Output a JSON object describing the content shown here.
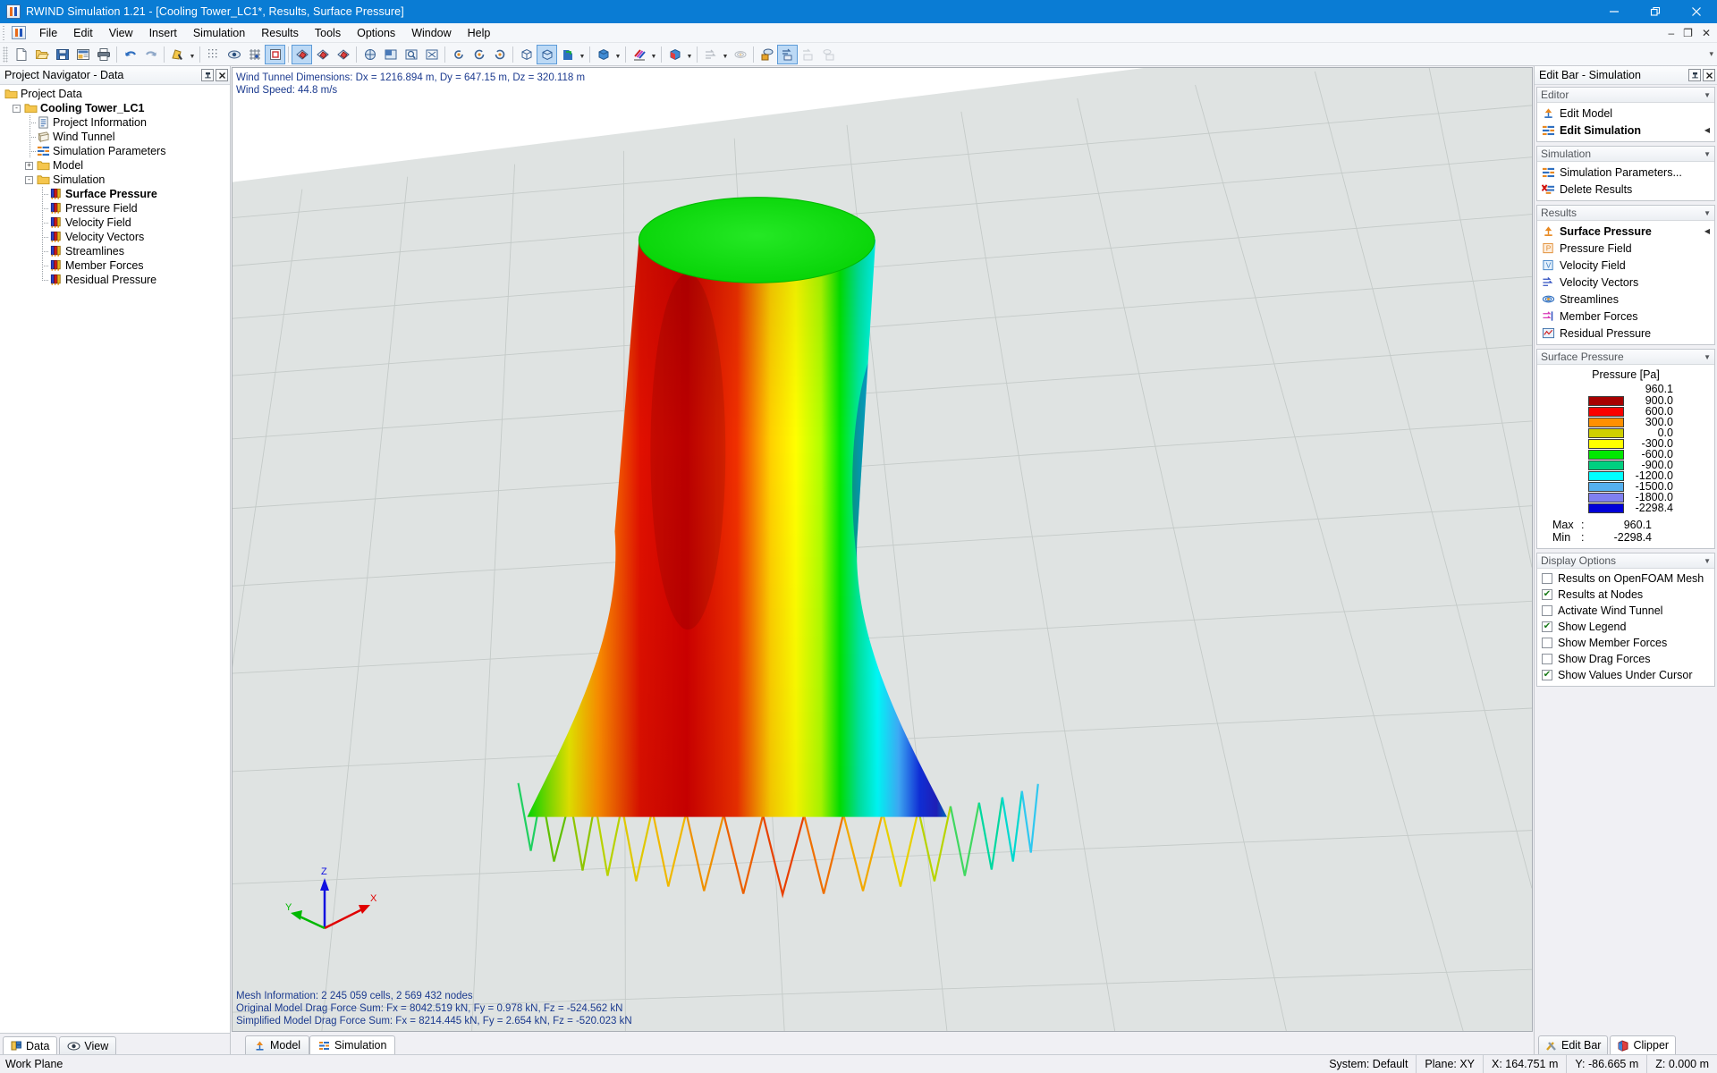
{
  "window": {
    "title": "RWIND Simulation 1.21 - [Cooling Tower_LC1*, Results, Surface Pressure]",
    "app_icon": "rwind-app-icon",
    "minimize": "–",
    "restore": "❐",
    "close": "✕"
  },
  "inner_window": {
    "minimize": "–",
    "restore": "❐",
    "close": "✕"
  },
  "menu": {
    "items": [
      {
        "label": "File"
      },
      {
        "label": "Edit"
      },
      {
        "label": "View"
      },
      {
        "label": "Insert"
      },
      {
        "label": "Simulation"
      },
      {
        "label": "Results"
      },
      {
        "label": "Tools"
      },
      {
        "label": "Options"
      },
      {
        "label": "Window"
      },
      {
        "label": "Help"
      }
    ]
  },
  "toolbar": {
    "groups": [
      {
        "buttons": [
          {
            "name": "new-icon"
          },
          {
            "name": "open-icon"
          },
          {
            "name": "save-icon"
          },
          {
            "name": "print-preview-icon"
          },
          {
            "name": "print-icon"
          }
        ]
      },
      {
        "buttons": [
          {
            "name": "undo-icon"
          },
          {
            "name": "redo-icon"
          }
        ]
      },
      {
        "buttons": [
          {
            "name": "select-objects-icon",
            "dropdown": true
          }
        ]
      },
      {
        "buttons": [
          {
            "name": "snap-grid-icon"
          },
          {
            "name": "object-snap-icon"
          },
          {
            "name": "grid-points-icon"
          },
          {
            "name": "work-plane-icon",
            "active": true
          }
        ]
      },
      {
        "buttons": [
          {
            "name": "view-xy-icon",
            "active": true
          },
          {
            "name": "view-xz-icon"
          },
          {
            "name": "view-yz-icon"
          }
        ]
      },
      {
        "buttons": [
          {
            "name": "pan-icon"
          },
          {
            "name": "zoom-window-icon"
          },
          {
            "name": "zoom-region-icon"
          },
          {
            "name": "zoom-all-icon"
          }
        ]
      },
      {
        "buttons": [
          {
            "name": "rotate-left-icon"
          },
          {
            "name": "rotate-icon"
          },
          {
            "name": "rotate-right-icon"
          }
        ]
      },
      {
        "buttons": [
          {
            "name": "wireframe-icon"
          },
          {
            "name": "solid-view-icon",
            "active": true
          },
          {
            "name": "render-mode-icon",
            "dropdown": true
          }
        ]
      },
      {
        "buttons": [
          {
            "name": "model-display-icon",
            "dropdown": true
          }
        ]
      },
      {
        "buttons": [
          {
            "name": "colors-icon",
            "dropdown": true
          }
        ]
      },
      {
        "buttons": [
          {
            "name": "surface-results-icon",
            "dropdown": true
          }
        ]
      },
      {
        "buttons": [
          {
            "name": "velocity-vectors-icon",
            "dropdown": true,
            "disabled": true
          },
          {
            "name": "streamlines-icon",
            "disabled": true
          }
        ]
      },
      {
        "buttons": [
          {
            "name": "results-on-surface-icon"
          },
          {
            "name": "results-values-icon",
            "active": true
          },
          {
            "name": "results-isolines-icon",
            "disabled": true
          },
          {
            "name": "results-table-icon",
            "disabled": true
          }
        ]
      }
    ],
    "overflow": "▾"
  },
  "project_navigator": {
    "title": "Project Navigator - Data",
    "pin_glyph": "⚲",
    "close_glyph": "✕",
    "tree": [
      {
        "label": "Project Data",
        "depth": 0,
        "icon": "folder-icon",
        "toggle": "none",
        "bold": false
      },
      {
        "label": "Cooling Tower_LC1",
        "depth": 1,
        "icon": "folder-icon",
        "toggle": "minus",
        "bold": true
      },
      {
        "label": "Project Information",
        "depth": 2,
        "icon": "document-icon",
        "toggle": "none",
        "bold": false
      },
      {
        "label": "Wind Tunnel",
        "depth": 2,
        "icon": "wind-tunnel-icon",
        "toggle": "none",
        "bold": false
      },
      {
        "label": "Simulation Parameters",
        "depth": 2,
        "icon": "sim-params-icon",
        "toggle": "none",
        "bold": false
      },
      {
        "label": "Model",
        "depth": 2,
        "icon": "folder-icon",
        "toggle": "plus",
        "bold": false
      },
      {
        "label": "Simulation",
        "depth": 2,
        "icon": "folder-icon",
        "toggle": "minus",
        "bold": false
      },
      {
        "label": "Surface Pressure",
        "depth": 3,
        "icon": "results-icon",
        "toggle": "none",
        "bold": true
      },
      {
        "label": "Pressure Field",
        "depth": 3,
        "icon": "results-icon",
        "toggle": "none",
        "bold": false
      },
      {
        "label": "Velocity Field",
        "depth": 3,
        "icon": "results-icon",
        "toggle": "none",
        "bold": false
      },
      {
        "label": "Velocity Vectors",
        "depth": 3,
        "icon": "results-icon",
        "toggle": "none",
        "bold": false
      },
      {
        "label": "Streamlines",
        "depth": 3,
        "icon": "results-icon",
        "toggle": "none",
        "bold": false
      },
      {
        "label": "Member Forces",
        "depth": 3,
        "icon": "results-icon",
        "toggle": "none",
        "bold": false
      },
      {
        "label": "Residual Pressure",
        "depth": 3,
        "icon": "results-icon",
        "toggle": "none",
        "bold": false
      }
    ],
    "tabs": [
      {
        "label": "Data",
        "icon": "data-icon",
        "selected": true
      },
      {
        "label": "View",
        "icon": "eye-icon",
        "selected": false
      }
    ]
  },
  "viewport": {
    "info_lines": [
      "Wind Tunnel Dimensions: Dx = 1216.894 m, Dy = 647.15 m, Dz = 320.118 m",
      "Wind Speed: 44.8 m/s"
    ],
    "bottom_lines": [
      "Mesh Information: 2 245 059 cells, 2 569 432 nodes",
      "Original Model Drag Force Sum: Fx = 8042.519 kN, Fy = 0.978 kN, Fz = -524.562 kN",
      "Simplified Model Drag Force Sum: Fx = 8214.445 kN, Fy = 2.654 kN, Fz = -520.023 kN"
    ],
    "axes": {
      "x": "X",
      "y": "Y",
      "z": "Z",
      "x_color": "#e00000",
      "y_color": "#00b800",
      "z_color": "#1010e0"
    },
    "tabs": [
      {
        "label": "Model",
        "icon": "model-icon",
        "selected": false
      },
      {
        "label": "Simulation",
        "icon": "simulation-icon",
        "selected": true
      }
    ]
  },
  "edit_bar": {
    "title": "Edit Bar - Simulation",
    "pin_glyph": "⚲",
    "close_glyph": "✕",
    "collapse_glyph": "▼",
    "sections": [
      {
        "title": "Editor",
        "items": [
          {
            "label": "Edit Model",
            "icon": "edit-model-icon",
            "bold": false,
            "arrow": false
          },
          {
            "label": "Edit Simulation",
            "icon": "edit-simulation-icon",
            "bold": true,
            "arrow": true
          }
        ]
      },
      {
        "title": "Simulation",
        "items": [
          {
            "label": "Simulation Parameters...",
            "icon": "sim-params-icon",
            "bold": false,
            "arrow": false
          },
          {
            "label": "Delete Results",
            "icon": "delete-results-icon",
            "bold": false,
            "arrow": false
          }
        ]
      },
      {
        "title": "Results",
        "items": [
          {
            "label": "Surface Pressure",
            "icon": "surface-pressure-icon",
            "bold": true,
            "arrow": true
          },
          {
            "label": "Pressure Field",
            "icon": "pressure-field-icon",
            "bold": false,
            "arrow": false
          },
          {
            "label": "Velocity Field",
            "icon": "velocity-field-icon",
            "bold": false,
            "arrow": false
          },
          {
            "label": "Velocity Vectors",
            "icon": "velocity-vectors-icon",
            "bold": false,
            "arrow": false
          },
          {
            "label": "Streamlines",
            "icon": "streamlines-icon",
            "bold": false,
            "arrow": false
          },
          {
            "label": "Member Forces",
            "icon": "member-forces-icon",
            "bold": false,
            "arrow": false
          },
          {
            "label": "Residual Pressure",
            "icon": "residual-pressure-icon",
            "bold": false,
            "arrow": false
          }
        ]
      }
    ],
    "legend_section_title": "Surface Pressure",
    "display_options_title": "Display Options",
    "display_options": [
      {
        "label": "Results on OpenFOAM Mesh",
        "checked": false
      },
      {
        "label": "Results at Nodes",
        "checked": true
      },
      {
        "label": "Activate Wind Tunnel",
        "checked": false
      },
      {
        "label": "Show Legend",
        "checked": true
      },
      {
        "label": "Show Member Forces",
        "checked": false
      },
      {
        "label": "Show Drag Forces",
        "checked": false
      },
      {
        "label": "Show Values Under Cursor",
        "checked": true
      }
    ],
    "tabs": [
      {
        "label": "Edit Bar",
        "icon": "tools-icon",
        "selected": false
      },
      {
        "label": "Clipper",
        "icon": "clipper-icon",
        "selected": true
      }
    ]
  },
  "chart_data": {
    "type": "heatmap",
    "title": "Pressure [Pa]",
    "unit": "Pa",
    "quantity": "Surface Pressure",
    "top_value": "960.1",
    "bands": [
      {
        "value": "900.0",
        "color": "#a80000"
      },
      {
        "value": "600.0",
        "color": "#fa0000"
      },
      {
        "value": "300.0",
        "color": "#ff9000"
      },
      {
        "value": "0.0",
        "color": "#cfcf00"
      },
      {
        "value": "-300.0",
        "color": "#ffff00"
      },
      {
        "value": "-600.0",
        "color": "#00e800"
      },
      {
        "value": "-900.0",
        "color": "#00d080"
      },
      {
        "value": "-1200.0",
        "color": "#00ffff"
      },
      {
        "value": "-1500.0",
        "color": "#55b0f0"
      },
      {
        "value": "-1800.0",
        "color": "#8080f0"
      },
      {
        "value": "-2298.4",
        "color": "#0000d8"
      }
    ],
    "max_label": "Max",
    "max_sep": ":",
    "max_value": "960.1",
    "min_label": "Min",
    "min_sep": ":",
    "min_value": "-2298.4"
  },
  "status_bar": {
    "left": "Work Plane",
    "cells": [
      {
        "label": "System: Default"
      },
      {
        "label": "Plane: XY"
      },
      {
        "label": "X:  164.751 m"
      },
      {
        "label": "Y:  -86.665 m"
      },
      {
        "label": "Z:  0.000 m"
      }
    ]
  }
}
